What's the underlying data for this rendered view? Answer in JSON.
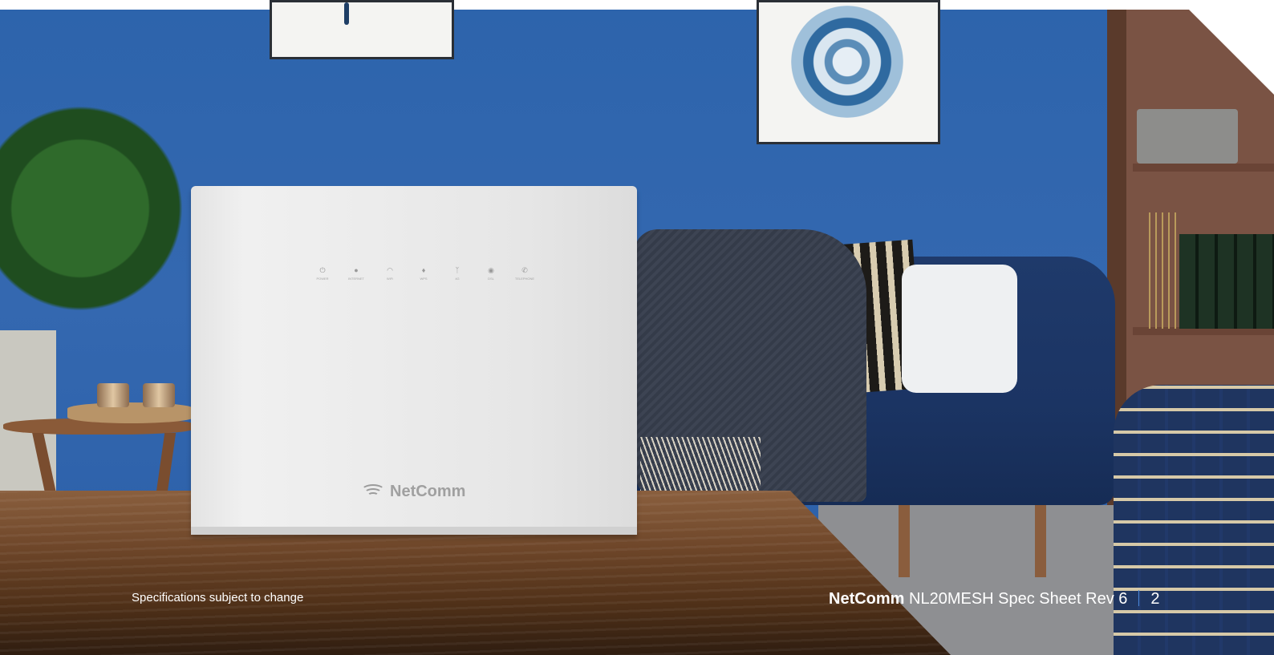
{
  "router": {
    "brand": "NetComm",
    "leds": [
      {
        "icon": "power-icon",
        "glyph": "⏻",
        "label": "POWER"
      },
      {
        "icon": "internet-icon",
        "glyph": "●",
        "label": "INTERNET"
      },
      {
        "icon": "wifi-icon",
        "glyph": "◠",
        "label": "WiFi"
      },
      {
        "icon": "wps-icon",
        "glyph": "♦",
        "label": "WPS"
      },
      {
        "icon": "antenna-icon",
        "glyph": "ᛉ",
        "label": "4G"
      },
      {
        "icon": "dsl-icon",
        "glyph": "◉",
        "label": "DSL"
      },
      {
        "icon": "telephone-icon",
        "glyph": "✆",
        "label": "TELEPHONE"
      }
    ]
  },
  "footer": {
    "disclaimer": "Specifications subject to change",
    "brand": "NetComm",
    "doc_title": "NL20MESH Spec Sheet Rev 6",
    "page_number": "2"
  },
  "colors": {
    "wall": "#3468b0",
    "separator": "#4a86d6",
    "footer_text": "#ffffff"
  }
}
